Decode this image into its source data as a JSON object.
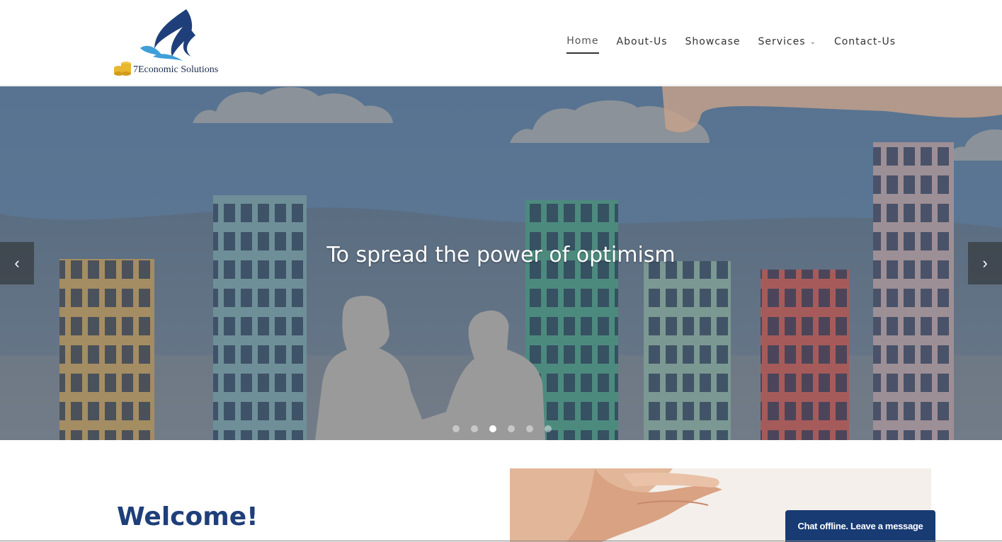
{
  "brand": {
    "logo_text": "7Economic Solutions",
    "icon": "bird-logo-icon",
    "colors": {
      "primary": "#1f3f7a",
      "light_blue": "#3f9fd8",
      "gold": "#e8b730"
    }
  },
  "nav": {
    "items": [
      {
        "label": "Home",
        "active": true
      },
      {
        "label": "About-Us",
        "active": false
      },
      {
        "label": "Showcase",
        "active": false
      },
      {
        "label": "Services",
        "active": false,
        "has_dropdown": true
      },
      {
        "label": "Contact-Us",
        "active": false
      }
    ],
    "dropdown_icon": "chevron-down-icon"
  },
  "hero": {
    "caption": "To spread the power of optimism",
    "prev_icon": "chevron-left-icon",
    "next_icon": "chevron-right-icon",
    "slide_count": 6,
    "active_slide": 3
  },
  "welcome": {
    "title": "Welcome!"
  },
  "chat": {
    "label": "Chat offline. Leave a message",
    "color": "#183b74"
  }
}
